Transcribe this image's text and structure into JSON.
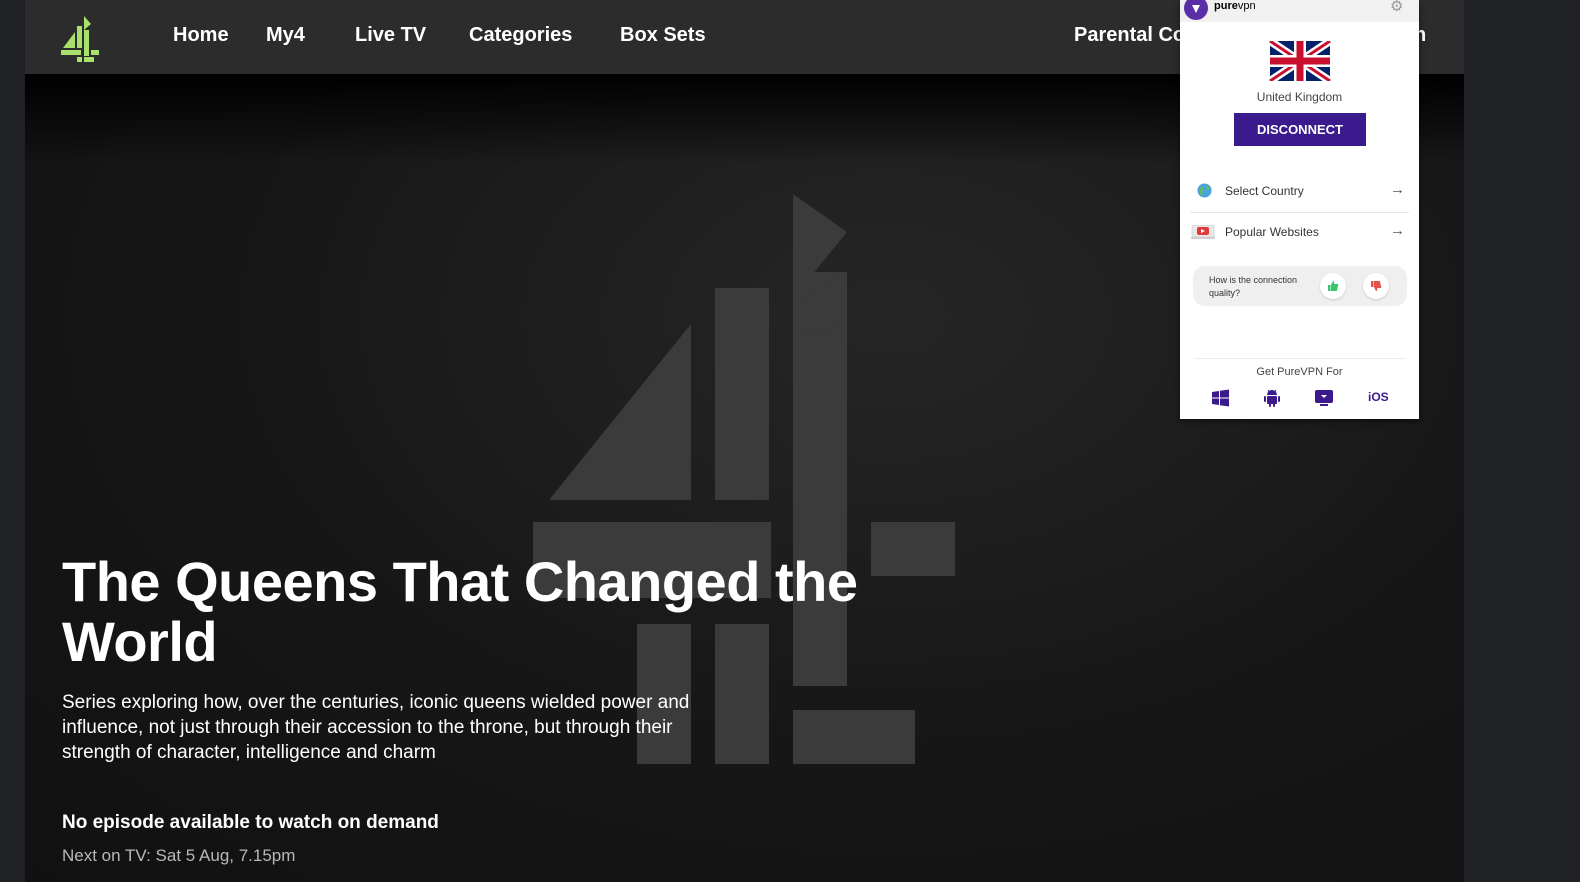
{
  "nav": {
    "logo": "channel-4-logo",
    "items": [
      {
        "label": "Home"
      },
      {
        "label": "My4"
      },
      {
        "label": "Live TV"
      },
      {
        "label": "Categories"
      },
      {
        "label": "Box Sets"
      },
      {
        "label": "Parental Co"
      },
      {
        "label": "n"
      }
    ]
  },
  "hero": {
    "title": "The Queens That Changed the World",
    "description": "Series exploring how, over the centuries, iconic queens wielded power and influence, not just through their accession to the throne, but through their strength of character, intelligence and charm",
    "availability": "No episode available to watch on demand",
    "next_on_tv": "Next on TV: Sat 5 Aug, 7.15pm",
    "background_logo": "channel-4-logo"
  },
  "vpn": {
    "brand_bold": "pure",
    "brand_light": "vpn",
    "country": "United Kingdom",
    "disconnect_label": "DISCONNECT",
    "menu": [
      {
        "label": "Select Country",
        "icon": "globe-icon"
      },
      {
        "label": "Popular Websites",
        "icon": "video-icon"
      }
    ],
    "feedback_question": "How is the connection quality?",
    "get_for": "Get PureVPN For",
    "platforms": [
      "windows-icon",
      "android-icon",
      "monitor-icon",
      "iOS"
    ],
    "ios_label": "iOS"
  },
  "colors": {
    "page_bg": "#141414",
    "navbar": "#2c2c2c",
    "c4_accent": "#a8e06b",
    "vpn_purple": "#3a1a8c",
    "thumbs_up": "#3cc46c",
    "thumbs_down": "#e0534f"
  }
}
